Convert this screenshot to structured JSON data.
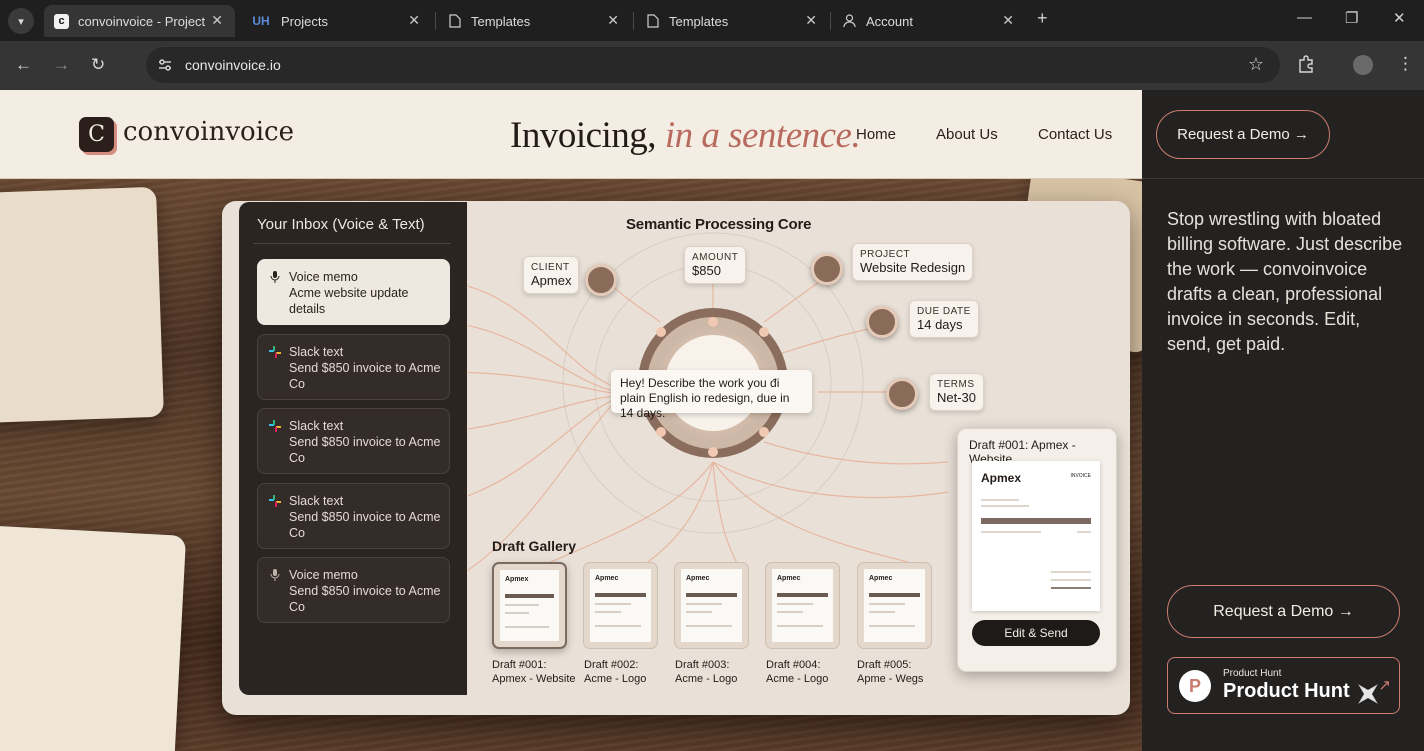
{
  "browser": {
    "tabs": [
      {
        "title": "convoinvoice - Project",
        "favicon": "c-logo-icon",
        "active": true
      },
      {
        "title": "Projects",
        "favicon": "uh-logo-icon",
        "active": false
      },
      {
        "title": "Templates",
        "favicon": "document-icon",
        "active": false
      },
      {
        "title": "Templates",
        "favicon": "document-icon",
        "active": false
      },
      {
        "title": "Account",
        "favicon": "person-icon",
        "active": false
      }
    ],
    "url": "convoinvoice.io"
  },
  "header": {
    "logo_letter": "C",
    "brand": "convoinvoice",
    "tagline_main": "Invoicing,",
    "tagline_italic": "in a sentence.",
    "nav": [
      "Home",
      "About Us",
      "Contact Us"
    ]
  },
  "sidebar": {
    "cta_top": "Request a Demo →",
    "description": "Stop wrestling with bloated billing software. Just describe the work — convoinvoice drafts a clean, professional invoice in seconds. Edit, send, get paid.",
    "cta_bottom": "Request a Demo →",
    "product_hunt_small": "Product Hunt",
    "product_hunt_big": "Product Hunt",
    "product_hunt_letter": "P"
  },
  "inbox": {
    "title": "Your Inbox (Voice & Text)",
    "items": [
      {
        "type": "Voice memo",
        "text": "Acme website update details",
        "icon": "microphone-icon",
        "active": true
      },
      {
        "type": "Slack text",
        "text": "Send $850 invoice to Acme Co",
        "icon": "slack-icon",
        "active": false
      },
      {
        "type": "Slack text",
        "text": "Send $850 invoice to Acme Co",
        "icon": "slack-icon",
        "active": false
      },
      {
        "type": "Slack text",
        "text": "Send $850 invoice to Acme Co",
        "icon": "slack-icon",
        "active": false
      },
      {
        "type": "Voice memo",
        "text": "Send $850 invoice to Acme Co",
        "icon": "microphone-icon",
        "active": false
      }
    ]
  },
  "core": {
    "title": "Semantic Processing Core",
    "fields": {
      "client": {
        "key": "CLIENT",
        "value": "Apmex"
      },
      "amount": {
        "key": "AMOUNT",
        "value": "$850"
      },
      "project": {
        "key": "PROJECT",
        "value": "Website Redesign"
      },
      "due": {
        "key": "DUE DATE",
        "value": "14 days"
      },
      "terms": {
        "key": "TERMS",
        "value": "Net-30"
      }
    },
    "prompt": "Hey! Describe the work you đi plain English io redesign, due in 14 days."
  },
  "gallery": {
    "title": "Draft Gallery",
    "drafts": [
      {
        "id": "Draft #001:",
        "name": "Apmex - Website",
        "brand": "Apmex"
      },
      {
        "id": "Draft #002:",
        "name": "Acme - Logo",
        "brand": "Apmec"
      },
      {
        "id": "Draft #003:",
        "name": "Acme - Logo",
        "brand": "Apmec"
      },
      {
        "id": "Draft #004:",
        "name": "Acme - Logo",
        "brand": "Apmec"
      },
      {
        "id": "Draft #005:",
        "name": "Apme - Wegs",
        "brand": "Apmec"
      }
    ]
  },
  "draft_preview": {
    "title": "Draft #001: Apmex - Website",
    "brand": "Apmex",
    "label": "INVOICE",
    "button": "Edit & Send"
  }
}
